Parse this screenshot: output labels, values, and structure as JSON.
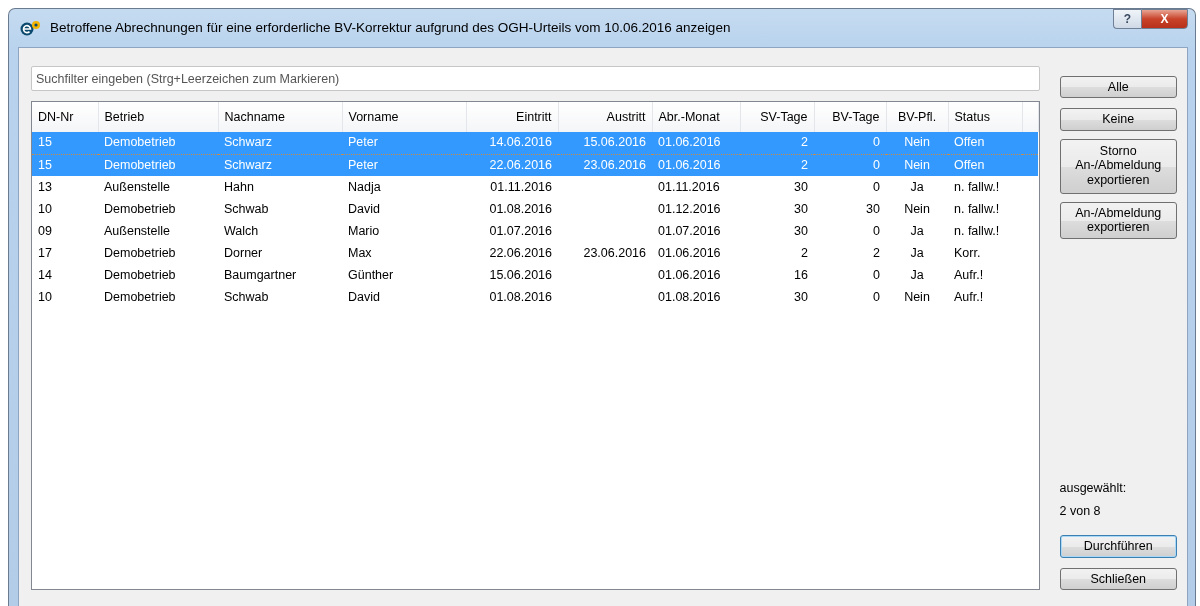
{
  "window": {
    "title": "Betroffene Abrechnungen für eine erforderliche BV-Korrektur aufgrund des OGH-Urteils vom 10.06.2016 anzeigen",
    "help_button": "?",
    "close_button": "X"
  },
  "search": {
    "placeholder": "Suchfilter eingeben (Strg+Leerzeichen zum Markieren)"
  },
  "table": {
    "columns": [
      "DN-Nr",
      "Betrieb",
      "Nachname",
      "Vorname",
      "Eintritt",
      "Austritt",
      "Abr.-Monat",
      "SV-Tage",
      "BV-Tage",
      "BV-Pfl.",
      "Status"
    ],
    "rows": [
      {
        "selected": true,
        "cells": [
          "15",
          "Demobetrieb",
          "Schwarz",
          "Peter",
          "14.06.2016",
          "15.06.2016",
          "01.06.2016",
          "2",
          "0",
          "Nein",
          "Offen"
        ]
      },
      {
        "selected": true,
        "cells": [
          "15",
          "Demobetrieb",
          "Schwarz",
          "Peter",
          "22.06.2016",
          "23.06.2016",
          "01.06.2016",
          "2",
          "0",
          "Nein",
          "Offen"
        ]
      },
      {
        "selected": false,
        "cells": [
          "13",
          "Außenstelle",
          "Hahn",
          "Nadja",
          "01.11.2016",
          "",
          "01.11.2016",
          "30",
          "0",
          "Ja",
          "n. fallw.!"
        ]
      },
      {
        "selected": false,
        "cells": [
          "10",
          "Demobetrieb",
          "Schwab",
          "David",
          "01.08.2016",
          "",
          "01.12.2016",
          "30",
          "30",
          "Nein",
          "n. fallw.!"
        ]
      },
      {
        "selected": false,
        "cells": [
          "09",
          "Außenstelle",
          "Walch",
          "Mario",
          "01.07.2016",
          "",
          "01.07.2016",
          "30",
          "0",
          "Ja",
          "n. fallw.!"
        ]
      },
      {
        "selected": false,
        "cells": [
          "17",
          "Demobetrieb",
          "Dorner",
          "Max",
          "22.06.2016",
          "23.06.2016",
          "01.06.2016",
          "2",
          "2",
          "Ja",
          "Korr."
        ]
      },
      {
        "selected": false,
        "cells": [
          "14",
          "Demobetrieb",
          "Baumgartner",
          "Günther",
          "15.06.2016",
          "",
          "01.06.2016",
          "16",
          "0",
          "Ja",
          "Aufr.!"
        ]
      },
      {
        "selected": false,
        "cells": [
          "10",
          "Demobetrieb",
          "Schwab",
          "David",
          "01.08.2016",
          "",
          "01.08.2016",
          "30",
          "0",
          "Nein",
          "Aufr.!"
        ]
      }
    ]
  },
  "side_buttons": [
    "Alle",
    "Keine",
    "Storno An-/Abmeldung exportieren",
    "An-/Abmeldung exportieren"
  ],
  "selection_label": "ausgewählt:",
  "selection_count": "2 von 8",
  "bottom_buttons": [
    {
      "label": "Durchführen",
      "default": true
    },
    {
      "label": "Schließen",
      "default": false
    }
  ]
}
